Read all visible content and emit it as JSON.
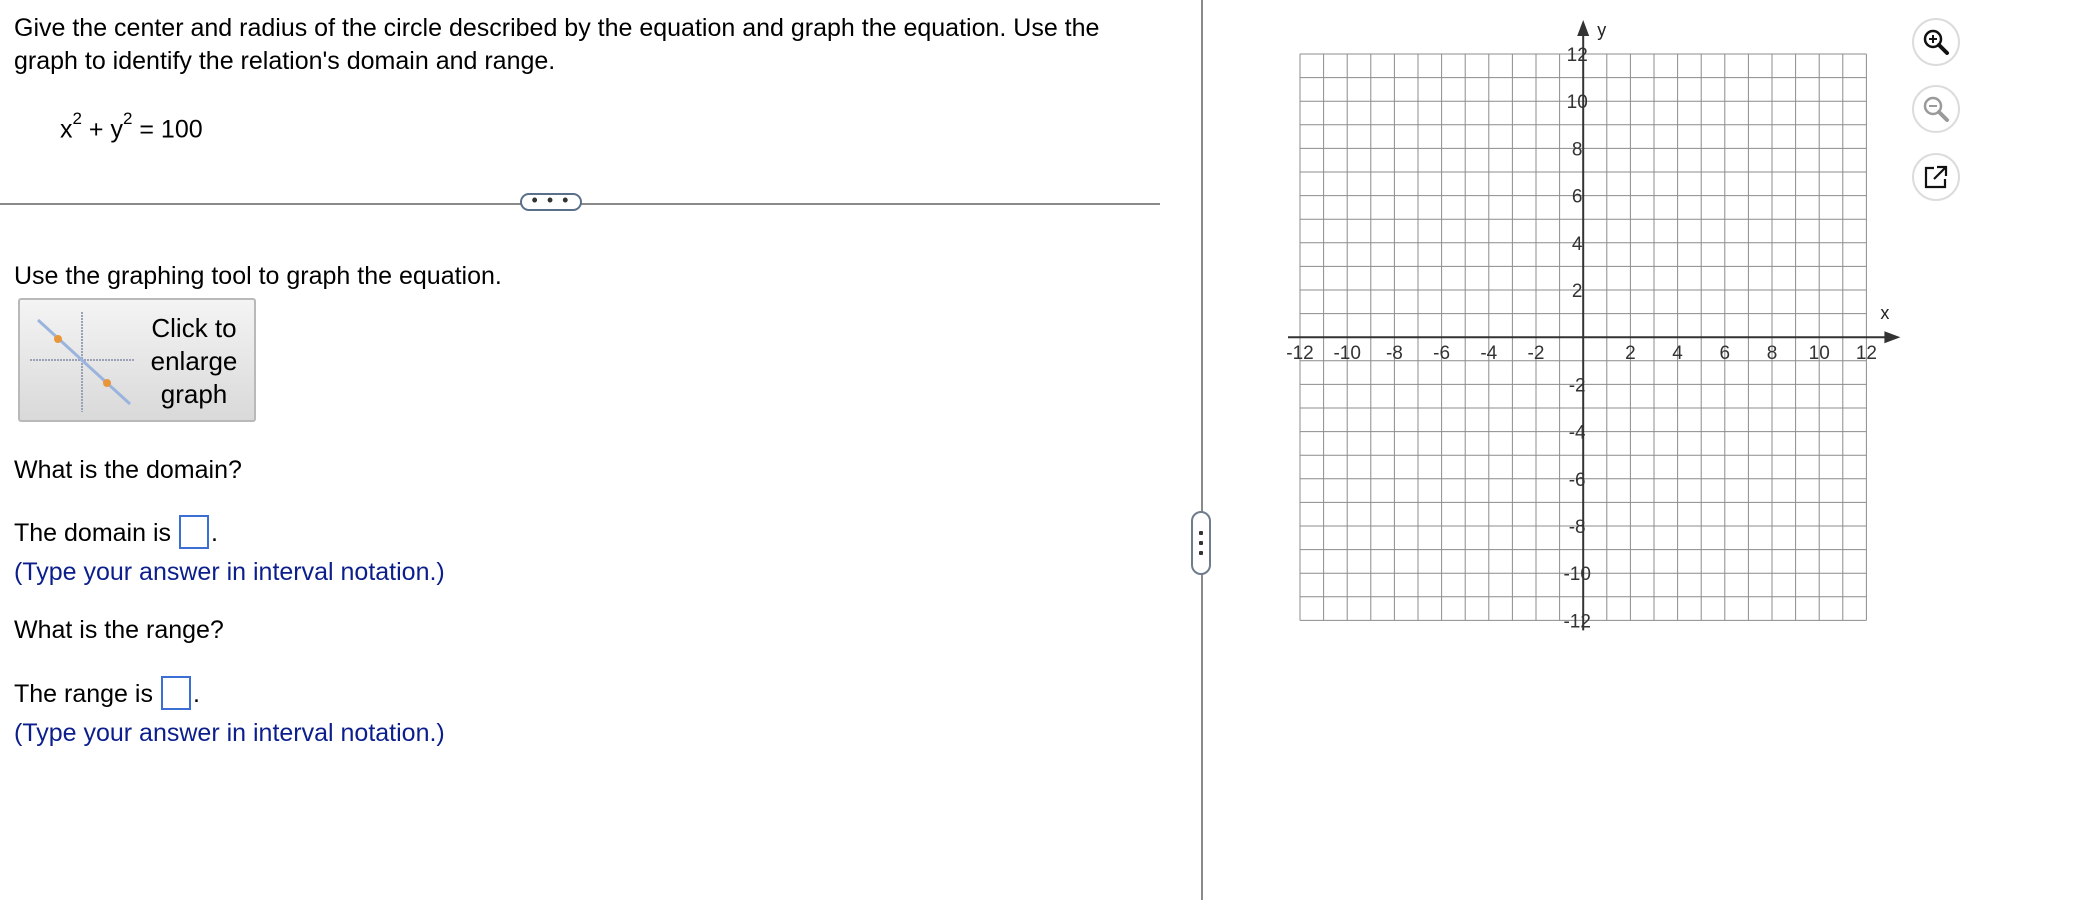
{
  "question": {
    "text": "Give the center and radius of the circle described by the equation and graph the equation. Use the graph to identify the relation's domain and range.",
    "equation": {
      "x_term": "x",
      "exp1": "2",
      "plus": " + ",
      "y_term": "y",
      "exp2": "2",
      "rhs": " = 100"
    }
  },
  "more_button": {
    "label": "• • •"
  },
  "instruction": "Use the graphing tool to graph the equation.",
  "enlarge_button": {
    "line1": "Click to",
    "line2": "enlarge",
    "line3": "graph"
  },
  "domain": {
    "question": "What is the domain?",
    "prefix": "The domain is",
    "suffix": ".",
    "hint": "(Type your answer in interval notation.)"
  },
  "range": {
    "question": "What is the range?",
    "prefix": "The range is",
    "suffix": ".",
    "hint": "(Type your answer in interval notation.)"
  },
  "graph": {
    "x_label": "x",
    "y_label": "y",
    "xmin": -12,
    "xmax": 12,
    "ymin": -12,
    "ymax": 12,
    "grid_step": 1,
    "label_step": 2,
    "x_tick_labels": [
      "-12",
      "-10",
      "-8",
      "-6",
      "-4",
      "-2",
      "2",
      "4",
      "6",
      "8",
      "10",
      "12"
    ],
    "y_tick_labels": [
      "12",
      "10",
      "8",
      "6",
      "4",
      "2",
      "-2",
      "-4",
      "-6",
      "-8",
      "-10",
      "-12"
    ],
    "grid": true
  },
  "tools": {
    "zoom_in": "zoom-in-icon",
    "zoom_out": "zoom-out-icon",
    "popout": "popout-icon"
  },
  "colors": {
    "hint_text": "#0b1e8c",
    "answer_box_border": "#3b6fd6"
  }
}
